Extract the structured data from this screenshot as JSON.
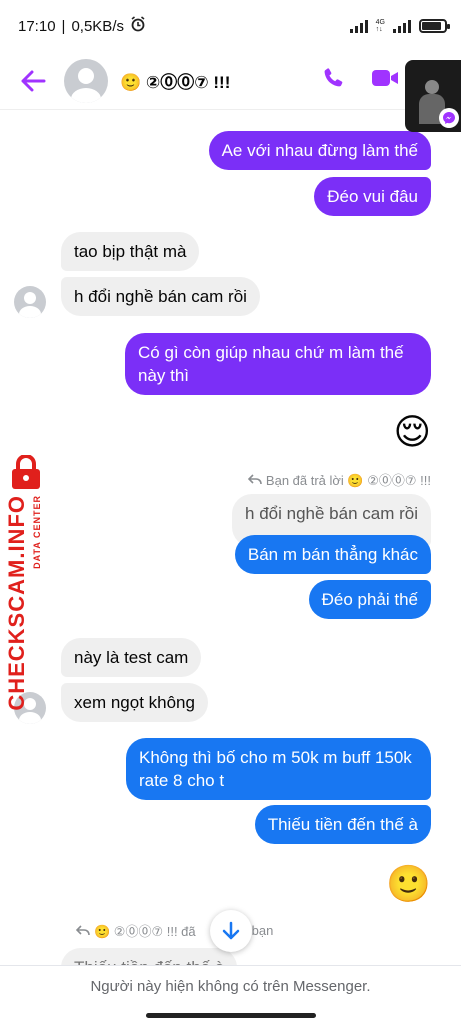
{
  "status_bar": {
    "time": "17:10",
    "speed": "0,5KB/s",
    "network": "4G"
  },
  "header": {
    "name": "🙂 ②⓪⓪⑦ !!!"
  },
  "colors": {
    "accent": "#a033ff",
    "outgoing_purple": "#7b2ff7",
    "outgoing_blue": "#1877f2",
    "incoming": "#efefef"
  },
  "messages": {
    "m1": "Ae với nhau đừng làm thế",
    "m2": "Đéo vui đâu",
    "m3": "tao bịp thật mà",
    "m4": "h đổi nghề bán cam rồi",
    "m5": "Có gì còn giúp nhau chứ m làm thế này thì",
    "m6": "😌",
    "m7_reply_note": "Bạn đã trả lời 🙂 ②⓪⓪⑦ !!!",
    "m7_quoted": "h đổi nghề bán cam rồi",
    "m8": "Bán m bán thẳng khác",
    "m9": "Đéo phải thế",
    "m10": "này là test cam",
    "m11": "xem ngọt không",
    "m12": "Không thì bố cho m 50k m buff 150k rate 8 cho t",
    "m13": "Thiếu tiền đến thế à",
    "m14": "🙂",
    "m15_reply_note_a": "🙂 ②⓪⓪⑦ !!! đã",
    "m15_reply_note_b": "bạn",
    "m15_quoted": "Thiếu tiền đến thế à"
  },
  "watermark": {
    "main": "CHECKSCAM.INFO",
    "sub": "DATA CENTER"
  },
  "footer": {
    "notice": "Người này hiện không có trên Messenger."
  }
}
